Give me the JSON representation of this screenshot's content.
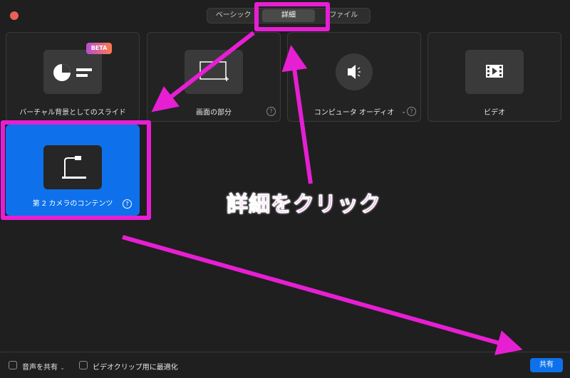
{
  "tabs": [
    {
      "label": "ベーシック",
      "active": false
    },
    {
      "label": "詳細",
      "active": true
    },
    {
      "label": "ファイル",
      "active": false
    }
  ],
  "cards": [
    {
      "label": "バーチャル背景としてのスライド",
      "badge": "BETA",
      "icon": "slides-icon",
      "help": false
    },
    {
      "label": "画面の部分",
      "icon": "screen-portion-icon",
      "help": true
    },
    {
      "label": "コンピュータ オーディオ",
      "icon": "speaker-icon",
      "help": true,
      "dropdown": true
    },
    {
      "label": "ビデオ",
      "icon": "video-icon",
      "help": false
    },
    {
      "label": "第 2 カメラのコンテンツ",
      "icon": "document-camera-icon",
      "help": true,
      "selected": true
    }
  ],
  "help_glyph": "?",
  "bottom": {
    "share_audio": "音声を共有",
    "optimize_video": "ビデオクリップ用に最適化",
    "share_button": "共有"
  },
  "annotation": {
    "text": "詳細をクリック",
    "color": "#e61fd3"
  },
  "colors": {
    "accent": "#0e71eb",
    "background": "#1f1f1f"
  }
}
